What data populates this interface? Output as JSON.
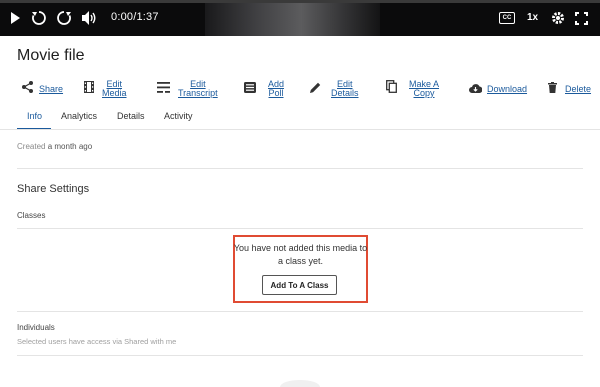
{
  "player": {
    "time": "0:00/1:37",
    "speed": "1x",
    "cc_label": "CC",
    "icons": [
      "play-icon",
      "rewind-icon",
      "forward-icon",
      "volume-icon",
      "cc-icon",
      "settings-icon",
      "fullscreen-icon"
    ]
  },
  "page": {
    "title": "Movie file"
  },
  "toolbar": {
    "items": [
      {
        "label": "Share",
        "icon": "share-icon"
      },
      {
        "label": "Edit\nMedia",
        "icon": "film-icon"
      },
      {
        "label": "Edit\nTranscript",
        "icon": "transcript-icon"
      },
      {
        "label": "Add\nPoll",
        "icon": "poll-icon"
      },
      {
        "label": "Edit\nDetails",
        "icon": "pencil-icon"
      },
      {
        "label": "Make A\nCopy",
        "icon": "copy-icon"
      },
      {
        "label": "Download",
        "icon": "cloud-download-icon"
      },
      {
        "label": "Delete",
        "icon": "trash-icon"
      }
    ]
  },
  "tabs": [
    {
      "label": "Info",
      "active": true
    },
    {
      "label": "Analytics",
      "active": false
    },
    {
      "label": "Details",
      "active": false
    },
    {
      "label": "Activity",
      "active": false
    }
  ],
  "info": {
    "created_prefix": "Created",
    "created_value": "a month ago"
  },
  "share_settings": {
    "heading": "Share Settings",
    "classes_label": "Classes",
    "notice": "You have not added this media to a class yet.",
    "add_button": "Add To A Class",
    "individuals_label": "Individuals",
    "individuals_sub": "Selected users have access via Shared with me"
  },
  "colors": {
    "accent": "#1b5a9c",
    "highlight": "#e04b33",
    "player_bg": "#0b0b0c"
  }
}
